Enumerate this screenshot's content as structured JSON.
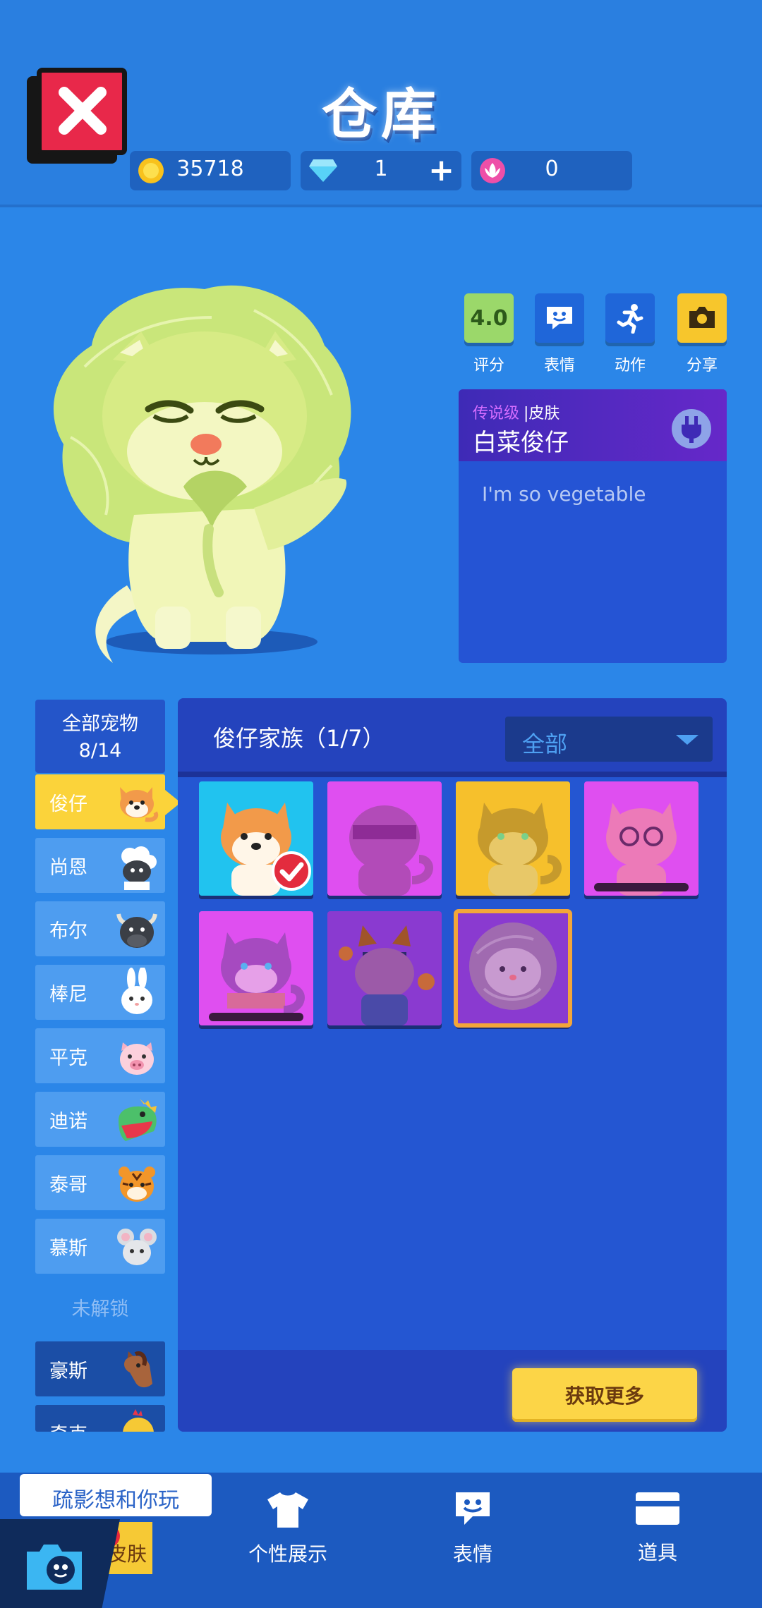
{
  "header": {
    "title": "仓库",
    "currencies": [
      {
        "icon": "gold-coin-icon",
        "value": "35718"
      },
      {
        "icon": "diamond-icon",
        "value": "1"
      },
      {
        "icon": "lotus-token-icon",
        "value": "0"
      }
    ],
    "plus_label": "+"
  },
  "actions": [
    {
      "icon": "rating-badge",
      "value": "4.0",
      "label": "评分",
      "color": "#9bd86a"
    },
    {
      "icon": "emote-icon",
      "label": "表情",
      "color": "#1f66d9"
    },
    {
      "icon": "running-icon",
      "label": "动作",
      "color": "#1f66d9"
    },
    {
      "icon": "camera-icon",
      "label": "分享",
      "color": "#f7c62c"
    }
  ],
  "skin_card": {
    "rarity": "传说级",
    "category": "皮肤",
    "name": "白菜俊仔",
    "description": "I'm so vegetable"
  },
  "pet_list": {
    "all_label": "全部宠物",
    "count": "8/14",
    "pets": [
      {
        "name": "俊仔",
        "selected": true
      },
      {
        "name": "尚恩"
      },
      {
        "name": "布尔"
      },
      {
        "name": "棒尼"
      },
      {
        "name": "平克"
      },
      {
        "name": "迪诺"
      },
      {
        "name": "泰哥"
      },
      {
        "name": "慕斯"
      }
    ],
    "locked_label": "未解锁",
    "locked_pets": [
      {
        "name": "豪斯"
      },
      {
        "name": "奇克"
      }
    ]
  },
  "panel": {
    "family_title": "俊仔家族（1/7）",
    "filter_label": "全部",
    "get_more_label": "获取更多"
  },
  "colors": {
    "background": "#2b86e8",
    "accent_yellow": "#fbd33a",
    "panel": "#2456d2",
    "legendary": "#d56dff"
  },
  "bottom_nav": {
    "invite_text": "疏影想和你玩",
    "tabs": [
      {
        "label": "宠物皮肤",
        "icon": "paw-icon"
      },
      {
        "label": "个性展示",
        "icon": "tshirt-icon"
      },
      {
        "label": "表情",
        "icon": "emote-icon"
      },
      {
        "label": "道具",
        "icon": "card-icon"
      }
    ]
  }
}
